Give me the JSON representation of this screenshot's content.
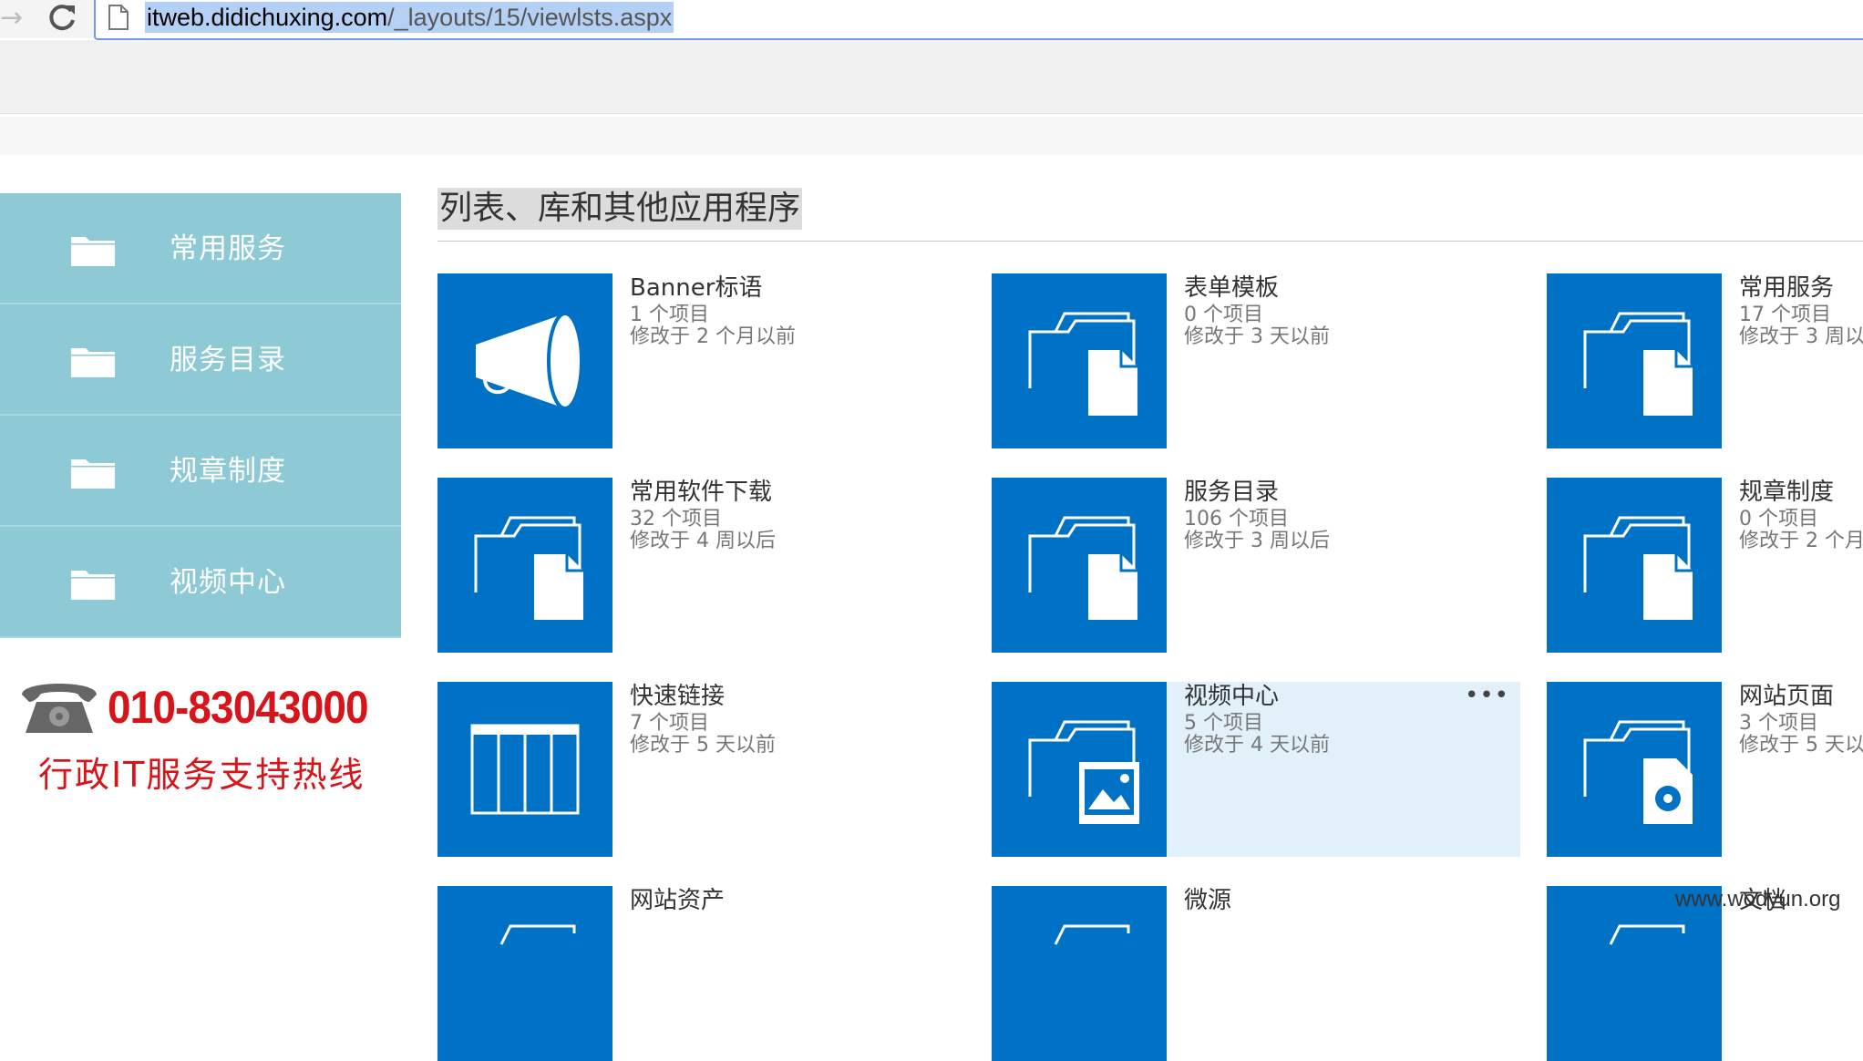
{
  "browser": {
    "url_host": "itweb.didichuxing.com",
    "url_path": "/_layouts/15/viewlsts.aspx"
  },
  "sidebar": {
    "items": [
      {
        "label": "常用服务"
      },
      {
        "label": "服务目录"
      },
      {
        "label": "规章制度"
      },
      {
        "label": "视频中心"
      }
    ]
  },
  "hotline": {
    "number": "010-83043000",
    "caption": "行政IT服务支持热线"
  },
  "main": {
    "title": "列表、库和其他应用程序",
    "tiles": [
      {
        "name": "Banner标语",
        "count": "1 个项目",
        "modified": "修改于 2 个月以前",
        "icon": "megaphone-icon"
      },
      {
        "name": "表单模板",
        "count": "0 个项目",
        "modified": "修改于 3 天以前",
        "icon": "folder-document-icon"
      },
      {
        "name": "常用服务",
        "count": "17 个项目",
        "modified": "修改于 3 周以",
        "icon": "folder-document-icon"
      },
      {
        "name": "常用软件下载",
        "count": "32 个项目",
        "modified": "修改于 4 周以后",
        "icon": "folder-document-icon"
      },
      {
        "name": "服务目录",
        "count": "106 个项目",
        "modified": "修改于 3 周以后",
        "icon": "folder-document-icon"
      },
      {
        "name": "规章制度",
        "count": "0 个项目",
        "modified": "修改于 2 个月",
        "icon": "folder-document-icon"
      },
      {
        "name": "快速链接",
        "count": "7 个项目",
        "modified": "修改于 5 天以前",
        "icon": "list-columns-icon"
      },
      {
        "name": "视频中心",
        "count": "5 个项目",
        "modified": "修改于 4 天以前",
        "icon": "folder-media-icon",
        "menu": "•••"
      },
      {
        "name": "网站页面",
        "count": "3 个项目",
        "modified": "修改于 5 天以",
        "icon": "folder-page-icon"
      },
      {
        "name": "网站资产",
        "count": "",
        "modified": "",
        "icon": "folder-icon"
      },
      {
        "name": "微源",
        "count": "",
        "modified": "",
        "icon": "folder-icon"
      },
      {
        "name": "文档",
        "count": "",
        "modified": "",
        "icon": "folder-icon"
      }
    ]
  },
  "watermark": "www.wodyun.org",
  "colors": {
    "tile_blue": "#0072c6",
    "sidebar_teal": "#8ecad6",
    "hotline_red": "#d7141a",
    "hover_bg": "#e2f0fa"
  }
}
